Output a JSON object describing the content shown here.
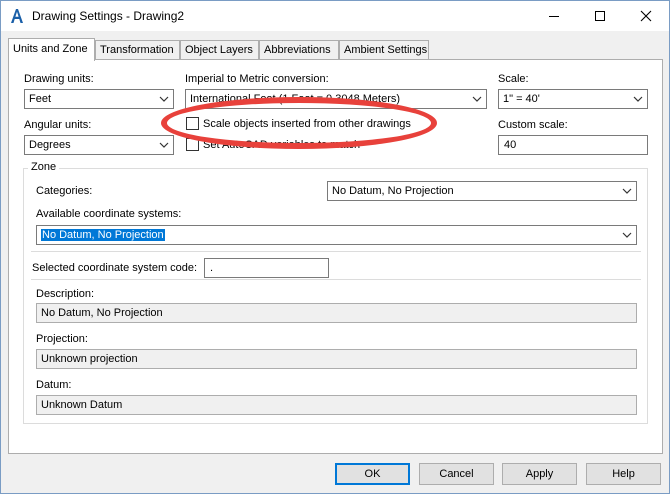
{
  "window": {
    "title": "Drawing Settings - Drawing2",
    "app_icon": "autocad-a-icon"
  },
  "tabs": [
    {
      "label": "Units and Zone",
      "active": true
    },
    {
      "label": "Transformation",
      "active": false
    },
    {
      "label": "Object Layers",
      "active": false
    },
    {
      "label": "Abbreviations",
      "active": false
    },
    {
      "label": "Ambient Settings",
      "active": false
    }
  ],
  "units": {
    "drawing_units_label": "Drawing units:",
    "drawing_units_value": "Feet",
    "conversion_label": "Imperial to Metric conversion:",
    "conversion_value": "International Foot (1 Foot = 0.3048 Meters)",
    "scale_label": "Scale:",
    "scale_value": "1\" = 40'",
    "angular_units_label": "Angular units:",
    "angular_units_value": "Degrees",
    "scale_objects_label": "Scale objects inserted from other drawings",
    "scale_objects_checked": false,
    "set_variables_label": "Set AutoCAD variables to match",
    "set_variables_checked": false,
    "custom_scale_label": "Custom scale:",
    "custom_scale_value": "40"
  },
  "zone": {
    "group_title": "Zone",
    "categories_label": "Categories:",
    "categories_value": "No Datum, No Projection",
    "available_label": "Available coordinate systems:",
    "available_value": "No Datum, No Projection",
    "selected_code_label": "Selected coordinate system code:",
    "selected_code_value": ".",
    "description_label": "Description:",
    "description_value": "No Datum, No Projection",
    "projection_label": "Projection:",
    "projection_value": "Unknown projection",
    "datum_label": "Datum:",
    "datum_value": "Unknown Datum"
  },
  "buttons": {
    "ok": "OK",
    "cancel": "Cancel",
    "apply": "Apply",
    "help": "Help"
  },
  "colors": {
    "highlight_oval": "#e8413b",
    "selection": "#0078d7"
  }
}
